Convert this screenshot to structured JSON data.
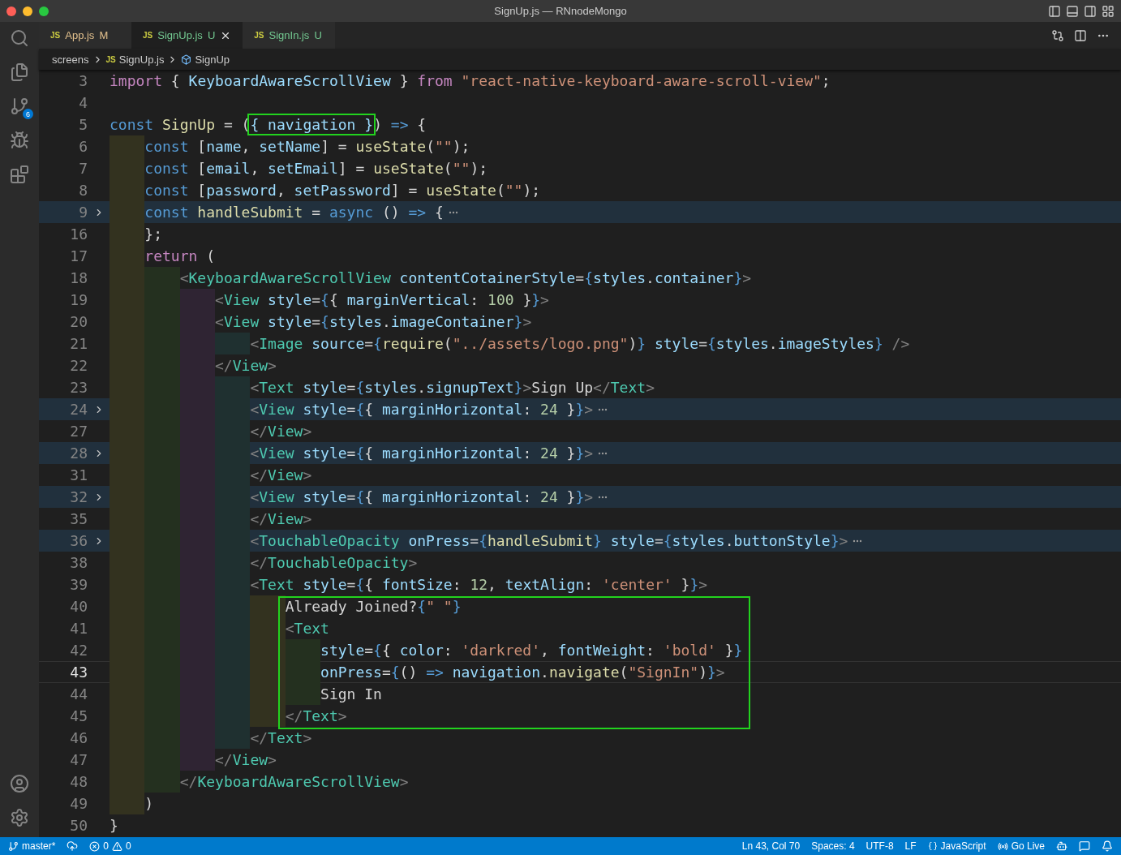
{
  "window": {
    "title": "SignUp.js — RNnodeMongo"
  },
  "activity_bar": {
    "source_control_badge": "6"
  },
  "tabs": [
    {
      "icon": "JS",
      "label": "App.js",
      "status": "M",
      "selected": false
    },
    {
      "icon": "JS",
      "label": "SignUp.js",
      "status": "U",
      "selected": true
    },
    {
      "icon": "JS",
      "label": "SignIn.js",
      "status": "U",
      "selected": false
    }
  ],
  "breadcrumbs": [
    {
      "kind": "folder",
      "label": "screens"
    },
    {
      "kind": "file",
      "icon": "JS",
      "label": "SignUp.js"
    },
    {
      "kind": "symbol",
      "label": "SignUp"
    }
  ],
  "editor": {
    "lines": [
      {
        "n": "3",
        "folded": false,
        "current": false,
        "boxed": false,
        "tokens": [
          {
            "kind": "kw",
            "text": "import"
          },
          {
            "kind": "p",
            "text": " { "
          },
          {
            "kind": "v",
            "text": "KeyboardAwareScrollView"
          },
          {
            "kind": "p",
            "text": " } "
          },
          {
            "kind": "kw",
            "text": "from"
          },
          {
            "kind": "s",
            "text": " \"react-native-keyboard-aware-scroll-view\""
          },
          {
            "kind": "p",
            "text": ";"
          }
        ]
      },
      {
        "n": "4",
        "current": false
      },
      {
        "n": "5",
        "folded": false,
        "current": false,
        "boxed": false,
        "tokens": [
          {
            "kind": "st",
            "text": "const"
          },
          {
            "kind": "f",
            "text": " SignUp"
          },
          {
            "kind": "p",
            "text": " = ("
          },
          {
            "kind": "v",
            "text": "{ navigation }",
            "boxed": true
          },
          {
            "kind": "p",
            "text": ") "
          },
          {
            "kind": "st",
            "text": "=>"
          },
          {
            "kind": "p",
            "text": " {"
          }
        ]
      },
      {
        "n": "6",
        "folded": false,
        "current": false,
        "boxed": false,
        "tokens": [
          {
            "kind": "st",
            "text": "    const"
          },
          {
            "kind": "p",
            "text": " ["
          },
          {
            "kind": "v",
            "text": "name"
          },
          {
            "kind": "p",
            "text": ", "
          },
          {
            "kind": "v",
            "text": "setName"
          },
          {
            "kind": "p",
            "text": "] = "
          },
          {
            "kind": "f",
            "text": "useState"
          },
          {
            "kind": "p",
            "text": "("
          },
          {
            "kind": "s",
            "text": "\"\""
          },
          {
            "kind": "p",
            "text": ");"
          }
        ]
      },
      {
        "n": "7",
        "folded": false,
        "current": false,
        "boxed": false,
        "tokens": [
          {
            "kind": "st",
            "text": "    const"
          },
          {
            "kind": "p",
            "text": " ["
          },
          {
            "kind": "v",
            "text": "email"
          },
          {
            "kind": "p",
            "text": ", "
          },
          {
            "kind": "v",
            "text": "setEmail"
          },
          {
            "kind": "p",
            "text": "] = "
          },
          {
            "kind": "f",
            "text": "useState"
          },
          {
            "kind": "p",
            "text": "("
          },
          {
            "kind": "s",
            "text": "\"\""
          },
          {
            "kind": "p",
            "text": ");"
          }
        ]
      },
      {
        "n": "8",
        "folded": false,
        "current": false,
        "boxed": false,
        "tokens": [
          {
            "kind": "st",
            "text": "    const"
          },
          {
            "kind": "p",
            "text": " ["
          },
          {
            "kind": "v",
            "text": "password"
          },
          {
            "kind": "p",
            "text": ", "
          },
          {
            "kind": "v",
            "text": "setPassword"
          },
          {
            "kind": "p",
            "text": "] = "
          },
          {
            "kind": "f",
            "text": "useState"
          },
          {
            "kind": "p",
            "text": "("
          },
          {
            "kind": "s",
            "text": "\"\""
          },
          {
            "kind": "p",
            "text": ");"
          }
        ]
      },
      {
        "n": "9",
        "folded": true,
        "current": false,
        "boxed": false,
        "tokens": [
          {
            "kind": "st",
            "text": "    const"
          },
          {
            "kind": "f",
            "text": " handleSubmit"
          },
          {
            "kind": "p",
            "text": " = "
          },
          {
            "kind": "st",
            "text": "async"
          },
          {
            "kind": "p",
            "text": " () "
          },
          {
            "kind": "st",
            "text": "=>"
          },
          {
            "kind": "p",
            "text": " {"
          }
        ]
      },
      {
        "n": "16",
        "folded": false,
        "current": false,
        "boxed": false,
        "tokens": [
          {
            "kind": "p",
            "text": "    };"
          }
        ]
      },
      {
        "n": "17",
        "folded": false,
        "current": false,
        "boxed": false,
        "tokens": [
          {
            "kind": "kw",
            "text": "    return"
          },
          {
            "kind": "p",
            "text": " ("
          }
        ]
      },
      {
        "n": "18",
        "folded": false,
        "current": false,
        "boxed": false,
        "tokens": [
          {
            "kind": "br",
            "text": "        <"
          },
          {
            "kind": "tag",
            "text": "KeyboardAwareScrollView"
          },
          {
            "kind": "v",
            "text": " contentCotainerStyle"
          },
          {
            "kind": "p",
            "text": "="
          },
          {
            "kind": "jb",
            "text": "{"
          },
          {
            "kind": "v",
            "text": "styles"
          },
          {
            "kind": "p",
            "text": "."
          },
          {
            "kind": "v",
            "text": "container"
          },
          {
            "kind": "jb",
            "text": "}"
          },
          {
            "kind": "br",
            "text": ">"
          }
        ]
      },
      {
        "n": "19",
        "folded": false,
        "current": false,
        "boxed": false,
        "tokens": [
          {
            "kind": "br",
            "text": "            <"
          },
          {
            "kind": "tag",
            "text": "View"
          },
          {
            "kind": "v",
            "text": " style"
          },
          {
            "kind": "p",
            "text": "="
          },
          {
            "kind": "jb",
            "text": "{"
          },
          {
            "kind": "p",
            "text": "{ "
          },
          {
            "kind": "v",
            "text": "marginVertical"
          },
          {
            "kind": "p",
            "text": ": "
          },
          {
            "kind": "n",
            "text": "100"
          },
          {
            "kind": "p",
            "text": " }"
          },
          {
            "kind": "jb",
            "text": "}"
          },
          {
            "kind": "br",
            "text": ">"
          }
        ]
      },
      {
        "n": "20",
        "folded": false,
        "current": false,
        "boxed": false,
        "tokens": [
          {
            "kind": "br",
            "text": "            <"
          },
          {
            "kind": "tag",
            "text": "View"
          },
          {
            "kind": "v",
            "text": " style"
          },
          {
            "kind": "p",
            "text": "="
          },
          {
            "kind": "jb",
            "text": "{"
          },
          {
            "kind": "v",
            "text": "styles"
          },
          {
            "kind": "p",
            "text": "."
          },
          {
            "kind": "v",
            "text": "imageContainer"
          },
          {
            "kind": "jb",
            "text": "}"
          },
          {
            "kind": "br",
            "text": ">"
          }
        ]
      },
      {
        "n": "21",
        "folded": false,
        "current": false,
        "boxed": false,
        "tokens": [
          {
            "kind": "br",
            "text": "                <"
          },
          {
            "kind": "tag",
            "text": "Image"
          },
          {
            "kind": "v",
            "text": " source"
          },
          {
            "kind": "p",
            "text": "="
          },
          {
            "kind": "jb",
            "text": "{"
          },
          {
            "kind": "f",
            "text": "require"
          },
          {
            "kind": "p",
            "text": "("
          },
          {
            "kind": "s",
            "text": "\"../assets/logo.png\""
          },
          {
            "kind": "p",
            "text": ")"
          },
          {
            "kind": "jb",
            "text": "}"
          },
          {
            "kind": "v",
            "text": " style"
          },
          {
            "kind": "p",
            "text": "="
          },
          {
            "kind": "jb",
            "text": "{"
          },
          {
            "kind": "v",
            "text": "styles"
          },
          {
            "kind": "p",
            "text": "."
          },
          {
            "kind": "v",
            "text": "imageStyles"
          },
          {
            "kind": "jb",
            "text": "}"
          },
          {
            "kind": "br",
            "text": " />"
          }
        ]
      },
      {
        "n": "22",
        "folded": false,
        "current": false,
        "boxed": false,
        "tokens": [
          {
            "kind": "br",
            "text": "            </"
          },
          {
            "kind": "tag",
            "text": "View"
          },
          {
            "kind": "br",
            "text": ">"
          }
        ]
      },
      {
        "n": "23",
        "folded": false,
        "current": false,
        "boxed": false,
        "tokens": [
          {
            "kind": "br",
            "text": "                <"
          },
          {
            "kind": "tag",
            "text": "Text"
          },
          {
            "kind": "v",
            "text": " style"
          },
          {
            "kind": "p",
            "text": "="
          },
          {
            "kind": "jb",
            "text": "{"
          },
          {
            "kind": "v",
            "text": "styles"
          },
          {
            "kind": "p",
            "text": "."
          },
          {
            "kind": "v",
            "text": "signupText"
          },
          {
            "kind": "jb",
            "text": "}"
          },
          {
            "kind": "br",
            "text": ">"
          },
          {
            "kind": "p",
            "text": "Sign Up"
          },
          {
            "kind": "br",
            "text": "</"
          },
          {
            "kind": "tag",
            "text": "Text"
          },
          {
            "kind": "br",
            "text": ">"
          }
        ]
      },
      {
        "n": "24",
        "folded": true,
        "current": false,
        "boxed": false,
        "tokens": [
          {
            "kind": "br",
            "text": "                <"
          },
          {
            "kind": "tag",
            "text": "View"
          },
          {
            "kind": "v",
            "text": " style"
          },
          {
            "kind": "p",
            "text": "="
          },
          {
            "kind": "jb",
            "text": "{"
          },
          {
            "kind": "p",
            "text": "{ "
          },
          {
            "kind": "v",
            "text": "marginHorizontal"
          },
          {
            "kind": "p",
            "text": ": "
          },
          {
            "kind": "n",
            "text": "24"
          },
          {
            "kind": "p",
            "text": " }"
          },
          {
            "kind": "jb",
            "text": "}"
          },
          {
            "kind": "br",
            "text": ">"
          }
        ]
      },
      {
        "n": "27",
        "folded": false,
        "current": false,
        "boxed": false,
        "tokens": [
          {
            "kind": "br",
            "text": "                </"
          },
          {
            "kind": "tag",
            "text": "View"
          },
          {
            "kind": "br",
            "text": ">"
          }
        ]
      },
      {
        "n": "28",
        "folded": true,
        "current": false,
        "boxed": false,
        "tokens": [
          {
            "kind": "br",
            "text": "                <"
          },
          {
            "kind": "tag",
            "text": "View"
          },
          {
            "kind": "v",
            "text": " style"
          },
          {
            "kind": "p",
            "text": "="
          },
          {
            "kind": "jb",
            "text": "{"
          },
          {
            "kind": "p",
            "text": "{ "
          },
          {
            "kind": "v",
            "text": "marginHorizontal"
          },
          {
            "kind": "p",
            "text": ": "
          },
          {
            "kind": "n",
            "text": "24"
          },
          {
            "kind": "p",
            "text": " }"
          },
          {
            "kind": "jb",
            "text": "}"
          },
          {
            "kind": "br",
            "text": ">"
          }
        ]
      },
      {
        "n": "31",
        "folded": false,
        "current": false,
        "boxed": false,
        "tokens": [
          {
            "kind": "br",
            "text": "                </"
          },
          {
            "kind": "tag",
            "text": "View"
          },
          {
            "kind": "br",
            "text": ">"
          }
        ]
      },
      {
        "n": "32",
        "folded": true,
        "current": false,
        "boxed": false,
        "tokens": [
          {
            "kind": "br",
            "text": "                <"
          },
          {
            "kind": "tag",
            "text": "View"
          },
          {
            "kind": "v",
            "text": " style"
          },
          {
            "kind": "p",
            "text": "="
          },
          {
            "kind": "jb",
            "text": "{"
          },
          {
            "kind": "p",
            "text": "{ "
          },
          {
            "kind": "v",
            "text": "marginHorizontal"
          },
          {
            "kind": "p",
            "text": ": "
          },
          {
            "kind": "n",
            "text": "24"
          },
          {
            "kind": "p",
            "text": " }"
          },
          {
            "kind": "jb",
            "text": "}"
          },
          {
            "kind": "br",
            "text": ">"
          }
        ]
      },
      {
        "n": "35",
        "folded": false,
        "current": false,
        "boxed": false,
        "tokens": [
          {
            "kind": "br",
            "text": "                </"
          },
          {
            "kind": "tag",
            "text": "View"
          },
          {
            "kind": "br",
            "text": ">"
          }
        ]
      },
      {
        "n": "36",
        "folded": true,
        "current": false,
        "boxed": false,
        "tokens": [
          {
            "kind": "br",
            "text": "                <"
          },
          {
            "kind": "tag",
            "text": "TouchableOpacity"
          },
          {
            "kind": "v",
            "text": " onPress"
          },
          {
            "kind": "p",
            "text": "="
          },
          {
            "kind": "jb",
            "text": "{"
          },
          {
            "kind": "f",
            "text": "handleSubmit"
          },
          {
            "kind": "jb",
            "text": "}"
          },
          {
            "kind": "v",
            "text": " style"
          },
          {
            "kind": "p",
            "text": "="
          },
          {
            "kind": "jb",
            "text": "{"
          },
          {
            "kind": "v",
            "text": "styles"
          },
          {
            "kind": "p",
            "text": "."
          },
          {
            "kind": "v",
            "text": "buttonStyle"
          },
          {
            "kind": "jb",
            "text": "}"
          },
          {
            "kind": "br",
            "text": ">"
          }
        ]
      },
      {
        "n": "38",
        "folded": false,
        "current": false,
        "boxed": false,
        "tokens": [
          {
            "kind": "br",
            "text": "                </"
          },
          {
            "kind": "tag",
            "text": "TouchableOpacity"
          },
          {
            "kind": "br",
            "text": ">"
          }
        ]
      },
      {
        "n": "39",
        "folded": false,
        "current": false,
        "boxed": false,
        "tokens": [
          {
            "kind": "br",
            "text": "                <"
          },
          {
            "kind": "tag",
            "text": "Text"
          },
          {
            "kind": "v",
            "text": " style"
          },
          {
            "kind": "p",
            "text": "="
          },
          {
            "kind": "jb",
            "text": "{"
          },
          {
            "kind": "p",
            "text": "{ "
          },
          {
            "kind": "v",
            "text": "fontSize"
          },
          {
            "kind": "p",
            "text": ": "
          },
          {
            "kind": "n",
            "text": "12"
          },
          {
            "kind": "p",
            "text": ", "
          },
          {
            "kind": "v",
            "text": "textAlign"
          },
          {
            "kind": "p",
            "text": ": "
          },
          {
            "kind": "s",
            "text": "'center'"
          },
          {
            "kind": "p",
            "text": " }"
          },
          {
            "kind": "jb",
            "text": "}"
          },
          {
            "kind": "br",
            "text": ">"
          }
        ]
      },
      {
        "n": "40",
        "folded": false,
        "current": false,
        "boxed": true,
        "tokens": [
          {
            "kind": "p",
            "text": "                    Already Joined?"
          },
          {
            "kind": "jb",
            "text": "{"
          },
          {
            "kind": "s",
            "text": "\" \""
          },
          {
            "kind": "jb",
            "text": "}"
          }
        ]
      },
      {
        "n": "41",
        "folded": false,
        "current": false,
        "boxed": true,
        "tokens": [
          {
            "kind": "br",
            "text": "                    <"
          },
          {
            "kind": "tag",
            "text": "Text"
          }
        ]
      },
      {
        "n": "42",
        "folded": false,
        "current": false,
        "boxed": true,
        "tokens": [
          {
            "kind": "v",
            "text": "                        style"
          },
          {
            "kind": "p",
            "text": "="
          },
          {
            "kind": "jb",
            "text": "{"
          },
          {
            "kind": "p",
            "text": "{ "
          },
          {
            "kind": "v",
            "text": "color"
          },
          {
            "kind": "p",
            "text": ": "
          },
          {
            "kind": "s",
            "text": "'darkred'"
          },
          {
            "kind": "p",
            "text": ", "
          },
          {
            "kind": "v",
            "text": "fontWeight"
          },
          {
            "kind": "p",
            "text": ": "
          },
          {
            "kind": "s",
            "text": "'bold'"
          },
          {
            "kind": "p",
            "text": " }"
          },
          {
            "kind": "jb",
            "text": "}"
          }
        ]
      },
      {
        "n": "43",
        "folded": false,
        "current": true,
        "boxed": true,
        "tokens": [
          {
            "kind": "v",
            "text": "                        onPress"
          },
          {
            "kind": "p",
            "text": "="
          },
          {
            "kind": "jb",
            "text": "{"
          },
          {
            "kind": "p",
            "text": "() "
          },
          {
            "kind": "st",
            "text": "=>"
          },
          {
            "kind": "v",
            "text": " navigation"
          },
          {
            "kind": "p",
            "text": "."
          },
          {
            "kind": "f",
            "text": "navigate"
          },
          {
            "kind": "p",
            "text": "("
          },
          {
            "kind": "s",
            "text": "\"SignIn\""
          },
          {
            "kind": "p",
            "text": ")"
          },
          {
            "kind": "jb",
            "text": "}"
          },
          {
            "kind": "br",
            "text": ">"
          }
        ]
      },
      {
        "n": "44",
        "folded": false,
        "current": false,
        "boxed": true,
        "tokens": [
          {
            "kind": "p",
            "text": "                        Sign In"
          }
        ]
      },
      {
        "n": "45",
        "folded": false,
        "current": false,
        "boxed": true,
        "tokens": [
          {
            "kind": "br",
            "text": "                    </"
          },
          {
            "kind": "tag",
            "text": "Text"
          },
          {
            "kind": "br",
            "text": ">"
          }
        ]
      },
      {
        "n": "46",
        "folded": false,
        "current": false,
        "boxed": false,
        "tokens": [
          {
            "kind": "br",
            "text": "                </"
          },
          {
            "kind": "tag",
            "text": "Text"
          },
          {
            "kind": "br",
            "text": ">"
          }
        ]
      },
      {
        "n": "47",
        "folded": false,
        "current": false,
        "boxed": false,
        "tokens": [
          {
            "kind": "br",
            "text": "            </"
          },
          {
            "kind": "tag",
            "text": "View"
          },
          {
            "kind": "br",
            "text": ">"
          }
        ]
      },
      {
        "n": "48",
        "folded": false,
        "current": false,
        "boxed": false,
        "tokens": [
          {
            "kind": "br",
            "text": "        </"
          },
          {
            "kind": "tag",
            "text": "KeyboardAwareScrollView"
          },
          {
            "kind": "br",
            "text": ">"
          }
        ]
      },
      {
        "n": "49",
        "folded": false,
        "current": false,
        "boxed": false,
        "tokens": [
          {
            "kind": "p",
            "text": "    )"
          }
        ]
      },
      {
        "n": "50",
        "folded": false,
        "current": false,
        "boxed": false,
        "tokens": [
          {
            "kind": "p",
            "text": "}"
          }
        ]
      }
    ]
  },
  "status_bar": {
    "branch": "master*",
    "errors": "0",
    "warnings": "0",
    "position": "Ln 43, Col 70",
    "spaces": "Spaces: 4",
    "encoding": "UTF-8",
    "eol": "LF",
    "language": "JavaScript",
    "go_live": "Go Live"
  }
}
